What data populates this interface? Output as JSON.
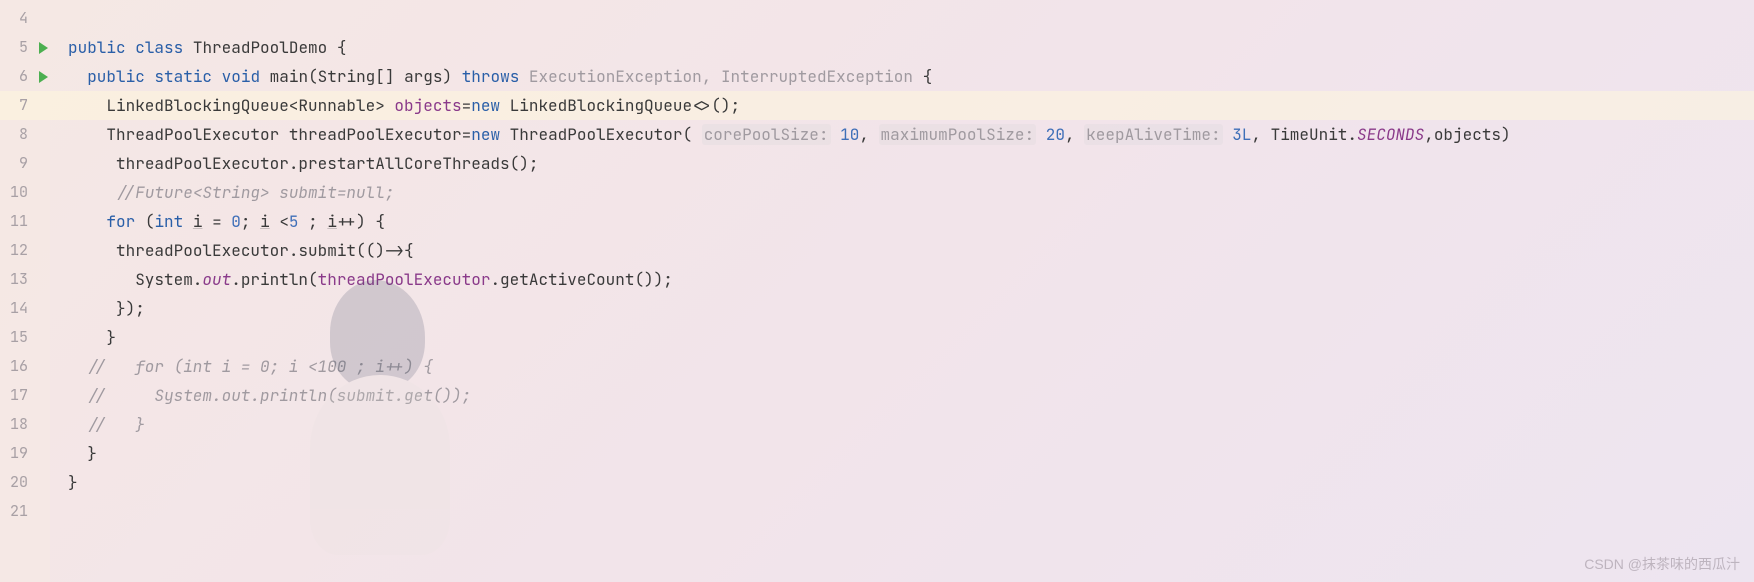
{
  "gutter": {
    "lines": [
      "4",
      "5",
      "6",
      "7",
      "8",
      "9",
      "10",
      "11",
      "12",
      "13",
      "14",
      "15",
      "16",
      "17",
      "18",
      "19",
      "20",
      "21"
    ],
    "runMarkers": [
      5,
      6
    ],
    "highlighted": 7
  },
  "code": {
    "l4": "",
    "l5": {
      "kw_public": "public",
      "kw_class": "class",
      "name": "ThreadPoolDemo",
      "brace": "{"
    },
    "l6": {
      "kw_public": "public",
      "kw_static": "static",
      "kw_void": "void",
      "method": "main",
      "params": "(String[] args)",
      "kw_throws": "throws",
      "ex1": "ExecutionException",
      "comma": ",",
      "ex2": "InterruptedException",
      "brace": "{"
    },
    "l7": {
      "type1": "LinkedBlockingQueue<Runnable>",
      "var": "objects",
      "eq": "=",
      "kw_new": "new",
      "ctor": "LinkedBlockingQueue<>();"
    },
    "l8": {
      "type1": "ThreadPoolExecutor",
      "var": "threadPoolExecutor",
      "eq": "=",
      "kw_new": "new",
      "ctor": "ThreadPoolExecutor(",
      "h1": "corePoolSize:",
      "n1": "10",
      "c1": ",",
      "h2": "maximumPoolSize:",
      "n2": "20",
      "c2": ",",
      "h3": "keepAliveTime:",
      "n3": "3L",
      "c3": ",",
      "tu": "TimeUnit.",
      "sec": "SECONDS",
      "tail": ",objects)"
    },
    "l9": {
      "text": "threadPoolExecutor.prestartAllCoreThreads();"
    },
    "l10": {
      "comment": "//Future<String> submit=null;"
    },
    "l11": {
      "kw_for": "for",
      "open": "(",
      "kw_int": "int",
      "i1": "i",
      "eq": " = ",
      "n0": "0",
      "sc1": ";",
      "i2": "i",
      "lt": " <",
      "n5": "5",
      "sc2": " ;",
      "i3": "i",
      "inc": "++)",
      "brace": "{"
    },
    "l12": {
      "text": "threadPoolExecutor.submit(()->{"
    },
    "l13": {
      "sys": "System.",
      "out": "out",
      "dot": ".println(",
      "ref": "threadPoolExecutor",
      "tail": ".getActiveCount());"
    },
    "l14": {
      "text": "});"
    },
    "l15": {
      "text": "}"
    },
    "l16": {
      "cm": "//",
      "text": "   for (int i = 0; i <100 ; i++) {"
    },
    "l17": {
      "cm": "//",
      "text": "     System.out.println(submit.get());"
    },
    "l18": {
      "cm": "//",
      "text": "   }"
    },
    "l19": {
      "text": "}"
    },
    "l20": {
      "text": "}"
    },
    "l21": ""
  },
  "watermark": "CSDN @抹茶味的西瓜汁"
}
